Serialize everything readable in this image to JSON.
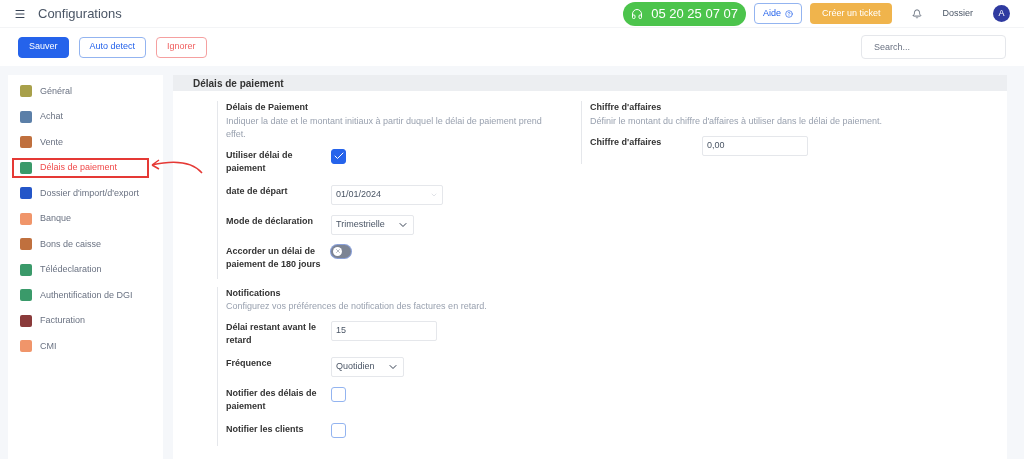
{
  "header": {
    "title": "Configurations",
    "phone": "05 20 25 07 07",
    "help": "Aide",
    "ticket": "Créer un ticket",
    "dossier": "Dossier",
    "avatar": "A"
  },
  "toolbar": {
    "buttons": [
      {
        "label": "Sauver",
        "kind": "primary"
      },
      {
        "label": "Auto detect",
        "kind": "outline"
      },
      {
        "label": "Ignorer",
        "kind": "danger"
      }
    ],
    "search": {
      "placeholder": "Search..."
    }
  },
  "sidebar": {
    "items": [
      {
        "label": "Général",
        "color": "#a8a04a",
        "selected": false
      },
      {
        "label": "Achat",
        "color": "#5b7fa8",
        "selected": false
      },
      {
        "label": "Vente",
        "color": "#c0703e",
        "selected": false
      },
      {
        "label": "Délais de paiement",
        "color": "#3a9a6a",
        "selected": true
      },
      {
        "label": "Dossier d'import/d'export",
        "color": "#2456c8",
        "selected": false
      },
      {
        "label": "Banque",
        "color": "#f0956a",
        "selected": false
      },
      {
        "label": "Bons de caisse",
        "color": "#c0703e",
        "selected": false
      },
      {
        "label": "Télédeclaration",
        "color": "#3a9a6a",
        "selected": false
      },
      {
        "label": "Authentification de DGI",
        "color": "#3a9a6a",
        "selected": false
      },
      {
        "label": "Facturation",
        "color": "#8a3a3a",
        "selected": false
      },
      {
        "label": "CMI",
        "color": "#f0956a",
        "selected": false
      }
    ]
  },
  "panel": {
    "title": "Délais de paiement",
    "left": {
      "title": "Délais de Paiement",
      "description": "Indiquer la date et le montant initiaux à partir duquel le délai de paiement prend effet.",
      "fields": [
        {
          "label": "Utiliser délai de paiement",
          "kind": "checkbox",
          "checked": true
        },
        {
          "label": "date de départ",
          "kind": "date",
          "value": "01/01/2024"
        },
        {
          "label": "Mode de déclaration",
          "kind": "select",
          "value": "Trimestrielle"
        },
        {
          "label": "Accorder un délai de paiement de 180 jours",
          "kind": "toggle",
          "on": false
        }
      ]
    },
    "notifications": {
      "title": "Notifications",
      "description": "Configurez vos préférences de notification des factures en retard.",
      "fields": [
        {
          "label": "Délai restant avant le retard",
          "kind": "text",
          "value": "15"
        },
        {
          "label": "Fréquence",
          "kind": "select",
          "value": "Quotidien"
        },
        {
          "label": "Notifier des délais de paiement",
          "kind": "checkbox",
          "checked": false
        },
        {
          "label": "Notifier les clients",
          "kind": "checkbox",
          "checked": false
        }
      ]
    },
    "right": {
      "title": "Chiffre d'affaires",
      "description": "Définir le montant du chiffre d'affaires à utiliser dans le délai de paiement.",
      "fields": [
        {
          "label": "Chiffre d'affaires",
          "kind": "text",
          "value": "0,00"
        }
      ]
    }
  }
}
